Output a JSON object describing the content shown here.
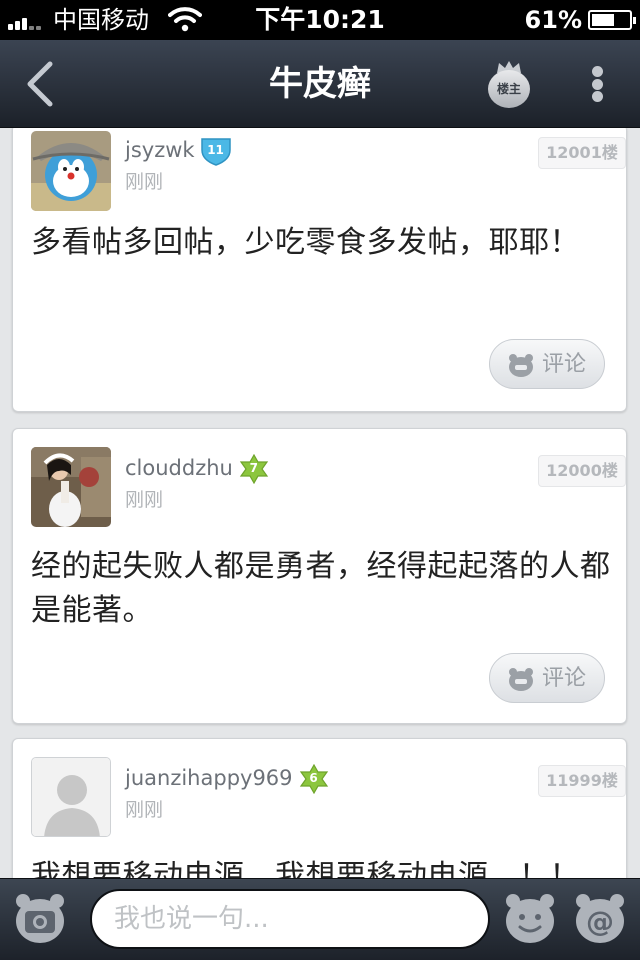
{
  "status_bar": {
    "carrier": "中国移动",
    "time": "下午10:21",
    "battery_pct": "61%",
    "battery_level": 0.61
  },
  "nav": {
    "title": "牛皮癣",
    "owner_label": "楼主",
    "back_icon": "chevron-left-icon",
    "more_icon": "more-vertical-icon"
  },
  "posts": [
    {
      "username": "jsyzwk",
      "level": "11",
      "level_color": "#4bb8e6",
      "time": "刚刚",
      "floor": "12001楼",
      "content": "多看帖多回帖，少吃零食多发帖，耶耶！",
      "comment_label": "评论"
    },
    {
      "username": "clouddzhu",
      "level": "7",
      "level_color": "#8cc63e",
      "time": "刚刚",
      "floor": "12000楼",
      "content": "经的起失败人都是勇者，经得起起落的人都是能著。",
      "comment_label": "评论"
    },
    {
      "username": "juanzihappy969",
      "level": "6",
      "level_color": "#8cc63e",
      "time": "刚刚",
      "floor": "11999楼",
      "content": "我想要移动电源，我想要移动电源，！！"
    }
  ],
  "composer": {
    "placeholder": "我也说一句..."
  },
  "colors": {
    "nav_bg": "#2a313b",
    "card_bg": "#ffffff",
    "feed_bg": "#e4e6e8"
  }
}
